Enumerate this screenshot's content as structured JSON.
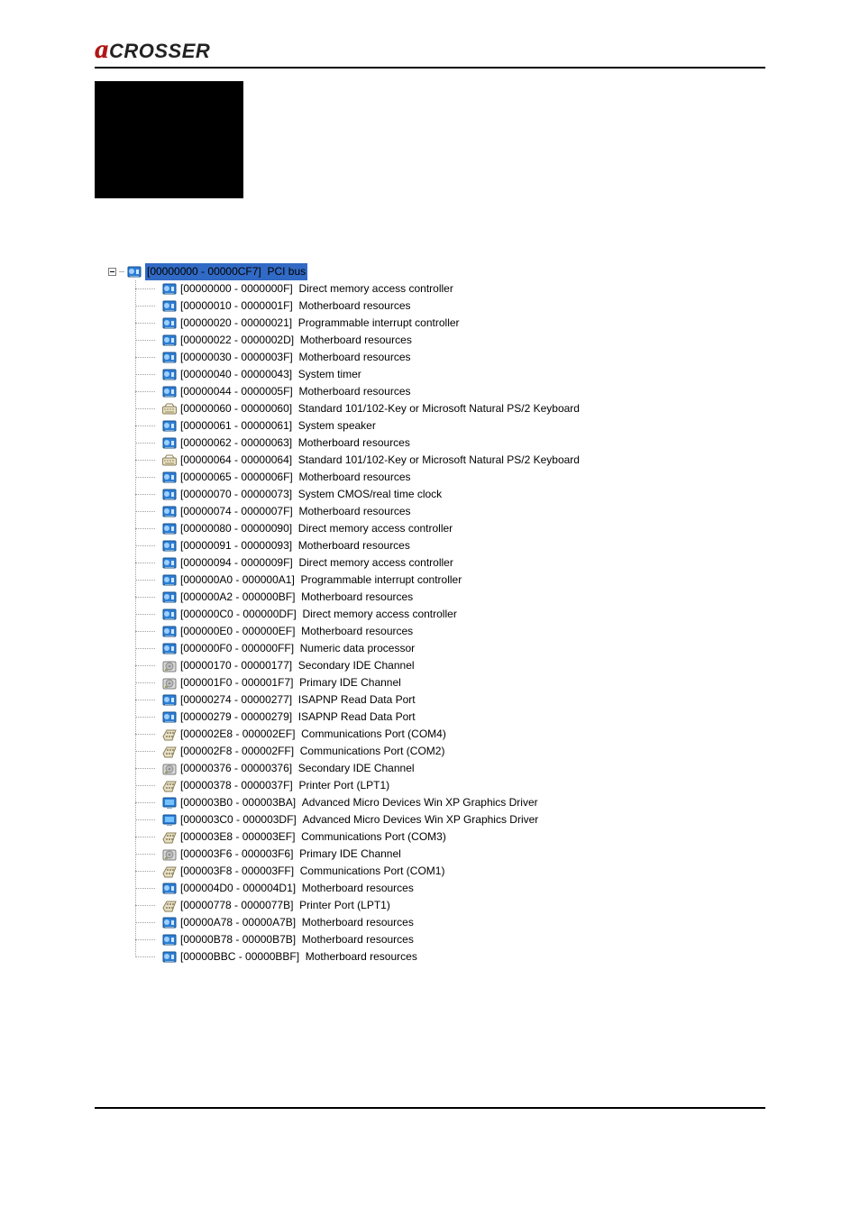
{
  "logo": {
    "initial": "a",
    "rest": "CROSSER"
  },
  "tree": {
    "root": {
      "range": "[00000000 - 00000CF7]",
      "label": "PCI bus",
      "icon": "sysblue"
    },
    "children": [
      {
        "icon": "sysblue",
        "range": "[00000000 - 0000000F]",
        "label": "Direct memory access controller"
      },
      {
        "icon": "sysblue",
        "range": "[00000010 - 0000001F]",
        "label": "Motherboard resources"
      },
      {
        "icon": "sysblue",
        "range": "[00000020 - 00000021]",
        "label": "Programmable interrupt controller"
      },
      {
        "icon": "sysblue",
        "range": "[00000022 - 0000002D]",
        "label": "Motherboard resources"
      },
      {
        "icon": "sysblue",
        "range": "[00000030 - 0000003F]",
        "label": "Motherboard resources"
      },
      {
        "icon": "sysblue",
        "range": "[00000040 - 00000043]",
        "label": "System timer"
      },
      {
        "icon": "sysblue",
        "range": "[00000044 - 0000005F]",
        "label": "Motherboard resources"
      },
      {
        "icon": "keyboard",
        "range": "[00000060 - 00000060]",
        "label": "Standard 101/102-Key or Microsoft Natural PS/2 Keyboard"
      },
      {
        "icon": "sysblue",
        "range": "[00000061 - 00000061]",
        "label": "System speaker"
      },
      {
        "icon": "sysblue",
        "range": "[00000062 - 00000063]",
        "label": "Motherboard resources"
      },
      {
        "icon": "keyboard",
        "range": "[00000064 - 00000064]",
        "label": "Standard 101/102-Key or Microsoft Natural PS/2 Keyboard"
      },
      {
        "icon": "sysblue",
        "range": "[00000065 - 0000006F]",
        "label": "Motherboard resources"
      },
      {
        "icon": "sysblue",
        "range": "[00000070 - 00000073]",
        "label": "System CMOS/real time clock"
      },
      {
        "icon": "sysblue",
        "range": "[00000074 - 0000007F]",
        "label": "Motherboard resources"
      },
      {
        "icon": "sysblue",
        "range": "[00000080 - 00000090]",
        "label": "Direct memory access controller"
      },
      {
        "icon": "sysblue",
        "range": "[00000091 - 00000093]",
        "label": "Motherboard resources"
      },
      {
        "icon": "sysblue",
        "range": "[00000094 - 0000009F]",
        "label": "Direct memory access controller"
      },
      {
        "icon": "sysblue",
        "range": "[000000A0 - 000000A1]",
        "label": "Programmable interrupt controller"
      },
      {
        "icon": "sysblue",
        "range": "[000000A2 - 000000BF]",
        "label": "Motherboard resources"
      },
      {
        "icon": "sysblue",
        "range": "[000000C0 - 000000DF]",
        "label": "Direct memory access controller"
      },
      {
        "icon": "sysblue",
        "range": "[000000E0 - 000000EF]",
        "label": "Motherboard resources"
      },
      {
        "icon": "sysblue",
        "range": "[000000F0 - 000000FF]",
        "label": "Numeric data processor"
      },
      {
        "icon": "disk",
        "range": "[00000170 - 00000177]",
        "label": "Secondary IDE Channel"
      },
      {
        "icon": "disk",
        "range": "[000001F0 - 000001F7]",
        "label": "Primary IDE Channel"
      },
      {
        "icon": "sysblue",
        "range": "[00000274 - 00000277]",
        "label": "ISAPNP Read Data Port"
      },
      {
        "icon": "sysblue",
        "range": "[00000279 - 00000279]",
        "label": "ISAPNP Read Data Port"
      },
      {
        "icon": "port",
        "range": "[000002E8 - 000002EF]",
        "label": "Communications Port (COM4)"
      },
      {
        "icon": "port",
        "range": "[000002F8 - 000002FF]",
        "label": "Communications Port (COM2)"
      },
      {
        "icon": "disk",
        "range": "[00000376 - 00000376]",
        "label": "Secondary IDE Channel"
      },
      {
        "icon": "port",
        "range": "[00000378 - 0000037F]",
        "label": "Printer Port (LPT1)"
      },
      {
        "icon": "display",
        "range": "[000003B0 - 000003BA]",
        "label": "Advanced Micro Devices Win XP Graphics Driver"
      },
      {
        "icon": "display",
        "range": "[000003C0 - 000003DF]",
        "label": "Advanced Micro Devices Win XP Graphics Driver"
      },
      {
        "icon": "port",
        "range": "[000003E8 - 000003EF]",
        "label": "Communications Port (COM3)"
      },
      {
        "icon": "disk",
        "range": "[000003F6 - 000003F6]",
        "label": "Primary IDE Channel"
      },
      {
        "icon": "port",
        "range": "[000003F8 - 000003FF]",
        "label": "Communications Port (COM1)"
      },
      {
        "icon": "sysblue",
        "range": "[000004D0 - 000004D1]",
        "label": "Motherboard resources"
      },
      {
        "icon": "port",
        "range": "[00000778 - 0000077B]",
        "label": "Printer Port (LPT1)"
      },
      {
        "icon": "sysblue",
        "range": "[00000A78 - 00000A7B]",
        "label": "Motherboard resources"
      },
      {
        "icon": "sysblue",
        "range": "[00000B78 - 00000B7B]",
        "label": "Motherboard resources"
      },
      {
        "icon": "sysblue",
        "range": "[00000BBC - 00000BBF]",
        "label": "Motherboard resources"
      }
    ]
  }
}
